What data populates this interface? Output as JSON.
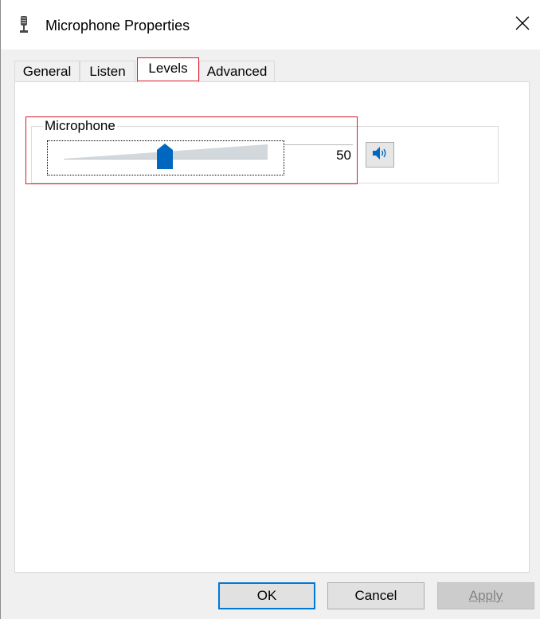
{
  "window": {
    "title": "Microphone Properties",
    "title_icon": "microphone-icon",
    "close_glyph": "✕"
  },
  "tabs": [
    {
      "label": "General",
      "active": false
    },
    {
      "label": "Listen",
      "active": false
    },
    {
      "label": "Levels",
      "active": true
    },
    {
      "label": "Advanced",
      "active": false
    }
  ],
  "levels": {
    "group_label": "Microphone",
    "slider_value": 50,
    "value_text": "50",
    "mute_icon": "speaker-icon"
  },
  "buttons": {
    "ok": "OK",
    "cancel": "Cancel",
    "apply": "Apply"
  },
  "colors": {
    "accent": "#0078d7",
    "highlight": "#d7192b"
  }
}
